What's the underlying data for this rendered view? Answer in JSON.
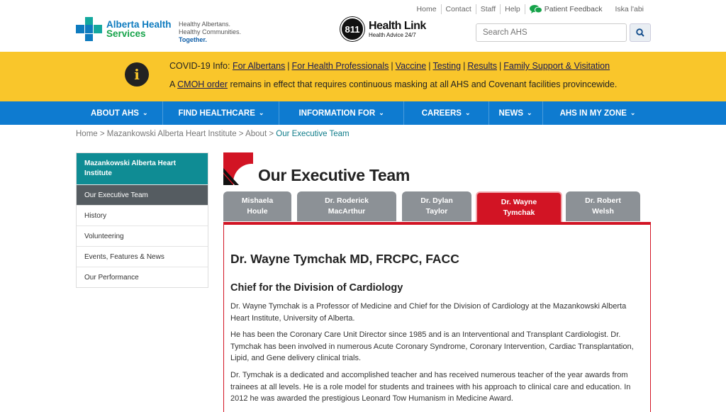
{
  "header": {
    "logo_line1": "Alberta Health",
    "logo_line2": "Services",
    "tagline1": "Healthy Albertans.",
    "tagline2": "Healthy Communities.",
    "tagline3": "Together.",
    "healthlink_number": "811",
    "healthlink_title": "Health Link",
    "healthlink_sub": "Health Advice 24/7",
    "toplinks": [
      "Home",
      "Contact",
      "Staff",
      "Help"
    ],
    "feedback_label": "Patient Feedback",
    "language_label": "Iska l'abi",
    "search_placeholder": "Search AHS"
  },
  "alert": {
    "prefix": "COVID-19 Info:",
    "links": [
      "For Albertans",
      "For Health Professionals",
      "Vaccine",
      "Testing",
      "Results",
      "Family Support & Visitation"
    ],
    "line2_prefix": "A",
    "line2_link": "CMOH order",
    "line2_text": "remains in effect that requires continuous masking at all AHS and Covenant facilities provincewide."
  },
  "nav": [
    "ABOUT AHS",
    "FIND HEALTHCARE",
    "INFORMATION FOR",
    "CAREERS",
    "NEWS",
    "AHS IN MY ZONE"
  ],
  "breadcrumb": {
    "items": [
      "Home",
      "Mazankowski Alberta Heart Institute",
      "About"
    ],
    "current": "Our Executive Team"
  },
  "sidebar": {
    "heading": "Mazankowski Alberta Heart Institute",
    "items": [
      "Our Executive Team",
      "History",
      "Volunteering",
      "Events, Features & News",
      "Our Performance"
    ]
  },
  "main": {
    "title": "Our Executive Team",
    "tabs": [
      {
        "line1": "Mishaela",
        "line2": "Houle"
      },
      {
        "line1": "Dr. Roderick",
        "line2": "MacArthur"
      },
      {
        "line1": "Dr. Dylan",
        "line2": "Taylor"
      },
      {
        "line1": "Dr. Wayne",
        "line2": "Tymchak"
      },
      {
        "line1": "Dr. Robert",
        "line2": "Welsh"
      }
    ],
    "person_name": "Dr. Wayne Tymchak MD, FRCPC, FACC",
    "person_role": "Chief for the Division of Cardiology",
    "paragraphs": [
      "Dr. Wayne Tymchak is a Professor of Medicine and Chief for the Division of Cardiology at the Mazankowski Alberta Heart Institute, University of Alberta.",
      "He has been the Coronary Care Unit Director since 1985 and is an Interventional and Transplant Cardiologist. Dr. Tymchak has been involved in numerous Acute Coronary Syndrome, Coronary Intervention, Cardiac Transplantation, Lipid, and Gene delivery clinical trials.",
      "Dr. Tymchak is a dedicated and accomplished teacher and has received numerous teacher of the year awards from trainees at all levels. He is a role model for students and trainees with his approach to clinical care and education. In 2012 he was awarded the prestigious Leonard Tow Humanism in Medicine Award."
    ]
  },
  "colors": {
    "brand_blue": "#0e7bd0",
    "alert_yellow": "#f9c62b",
    "sidebar_teal": "#0f8c94",
    "active_tab_red": "#d21424",
    "tab_gray": "#8c9196"
  }
}
